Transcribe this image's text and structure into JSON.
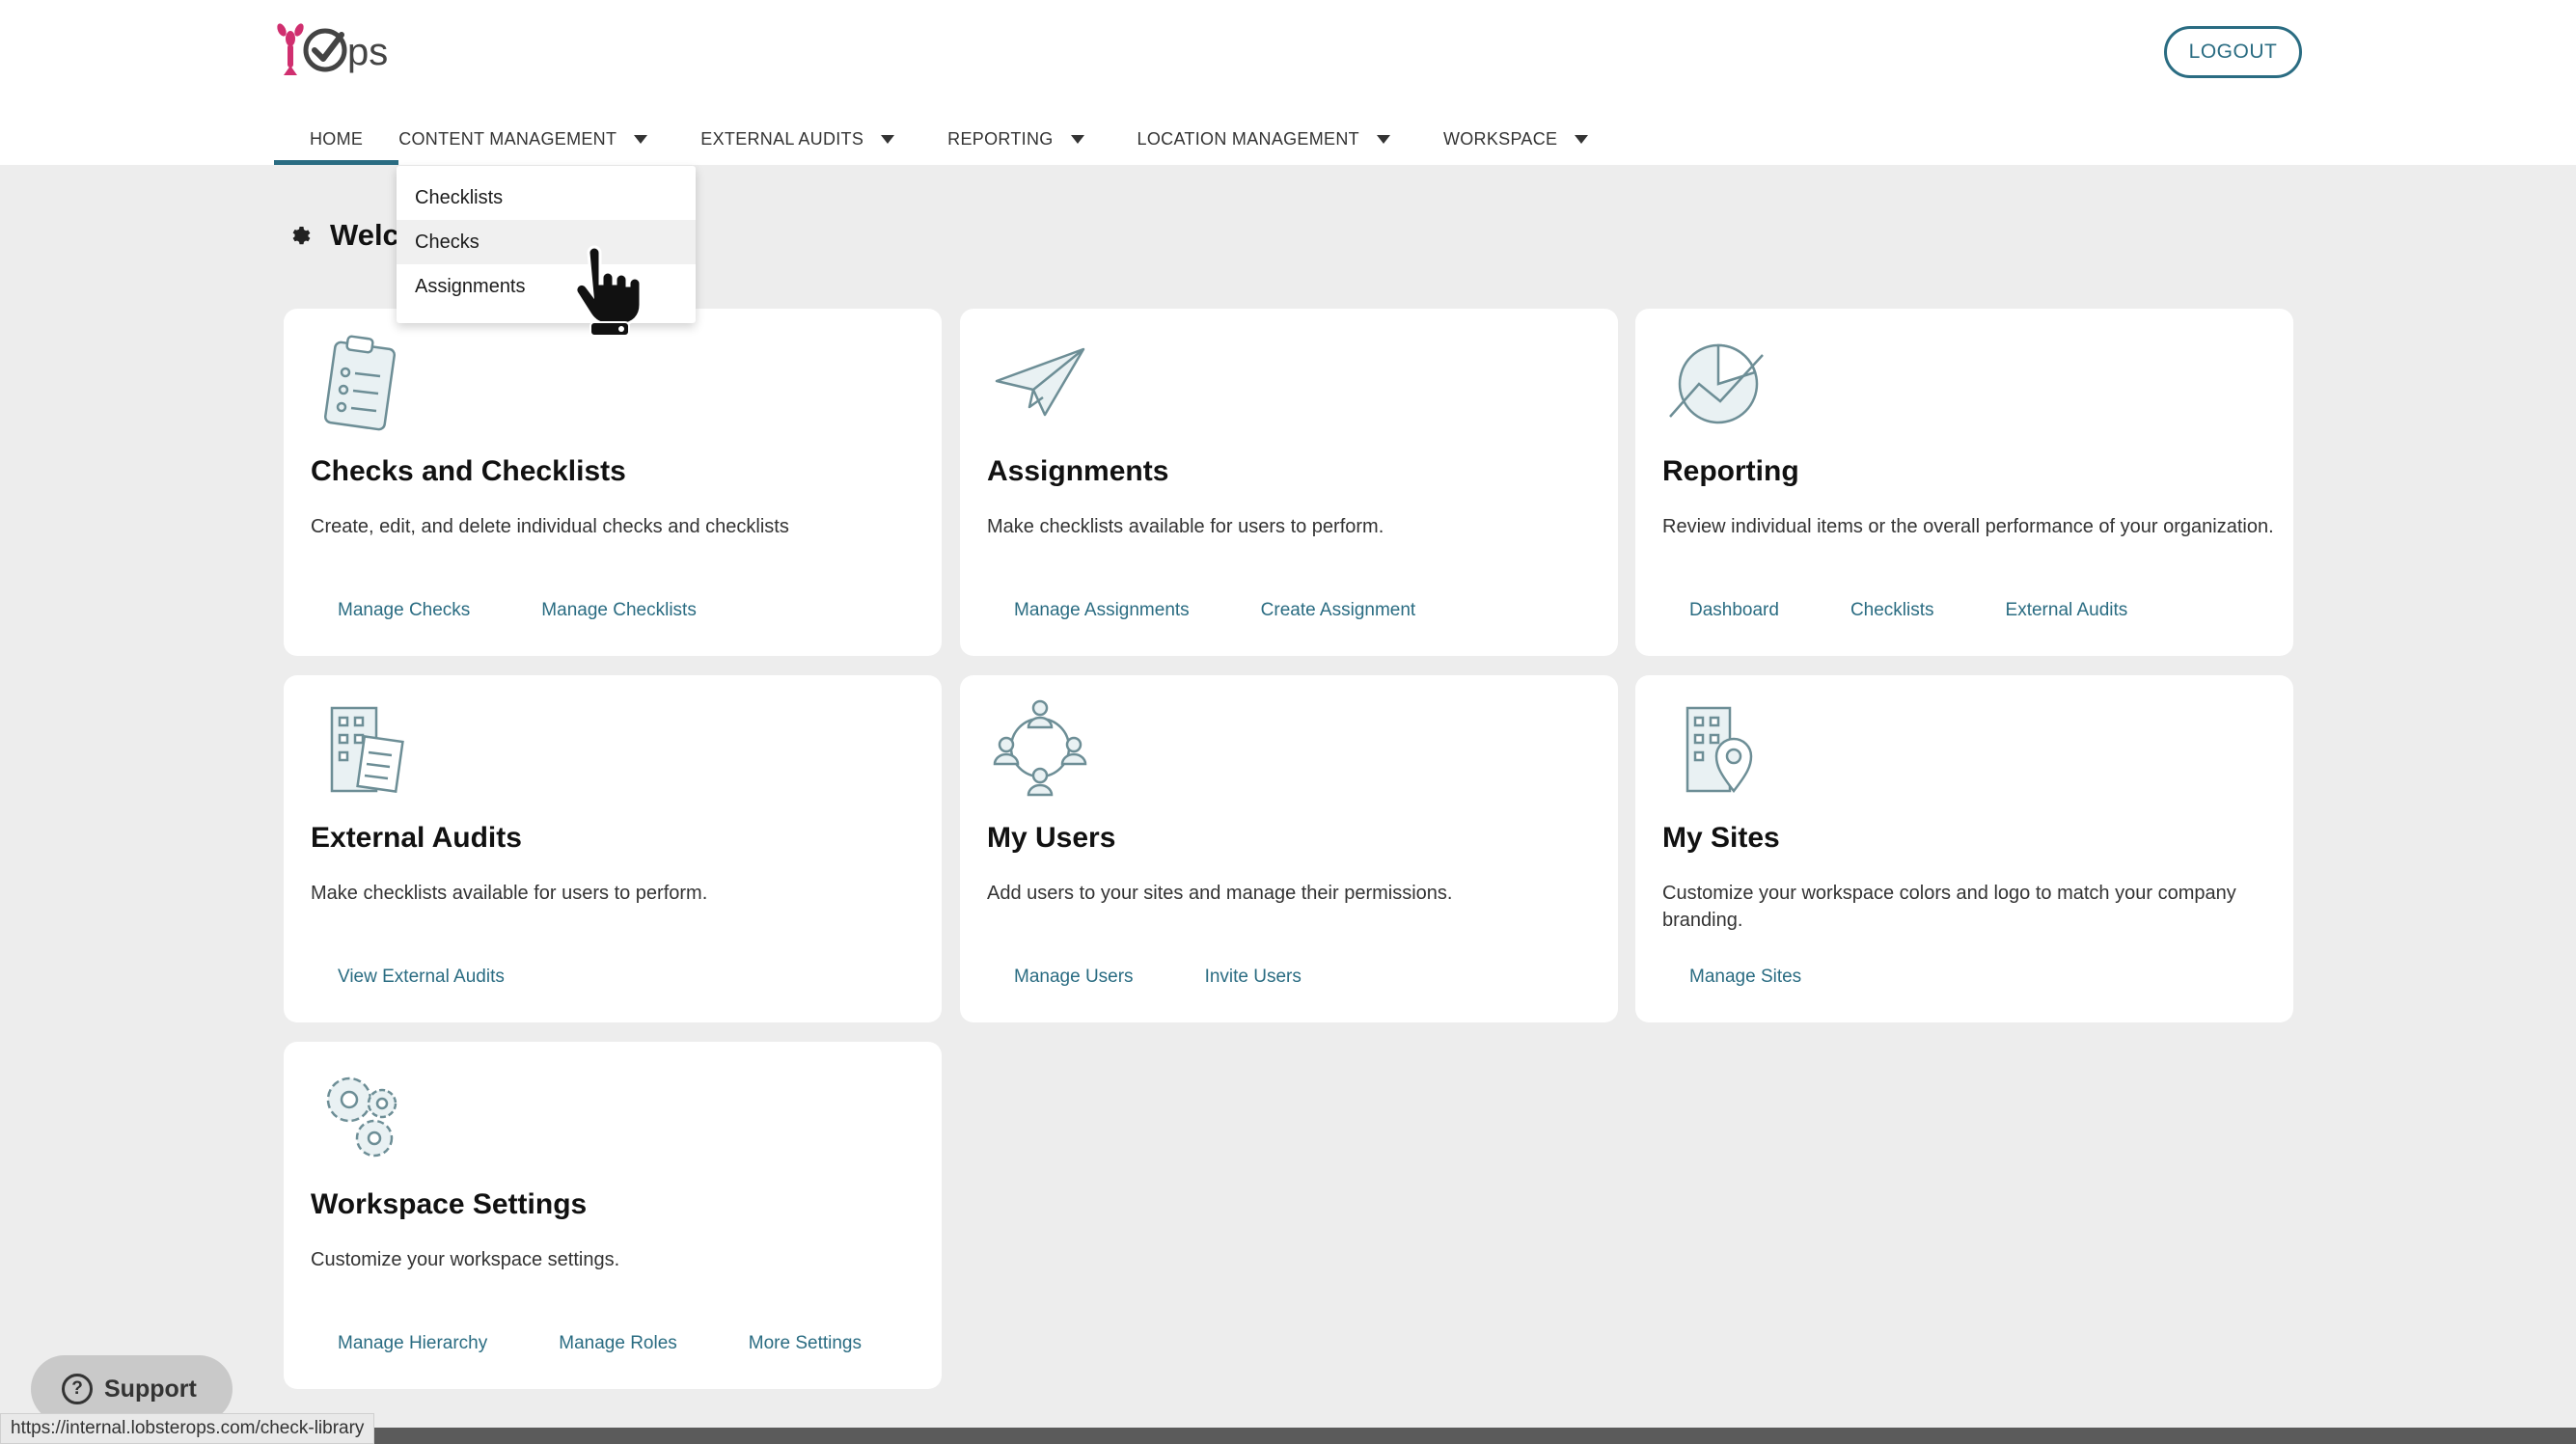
{
  "header": {
    "logo_text": "Ops",
    "logout_label": "LOGOUT"
  },
  "nav": {
    "items": [
      {
        "label": "HOME"
      },
      {
        "label": "CONTENT MANAGEMENT"
      },
      {
        "label": "EXTERNAL AUDITS"
      },
      {
        "label": "REPORTING"
      },
      {
        "label": "LOCATION MANAGEMENT"
      },
      {
        "label": "WORKSPACE"
      }
    ],
    "active": "HOME"
  },
  "dropdown": {
    "items": [
      {
        "label": "Checklists"
      },
      {
        "label": "Checks"
      },
      {
        "label": "Assignments"
      }
    ],
    "hovered": "Checks"
  },
  "welcome": {
    "title": "Welc"
  },
  "cards": [
    {
      "title": "Checks and Checklists",
      "desc": "Create, edit, and delete individual checks and checklists",
      "links": [
        "Manage Checks",
        "Manage Checklists"
      ],
      "icon": "clipboard-icon"
    },
    {
      "title": "Assignments",
      "desc": "Make checklists available for users to perform.",
      "links": [
        "Manage Assignments",
        "Create Assignment"
      ],
      "icon": "paper-plane-icon"
    },
    {
      "title": "Reporting",
      "desc": "Review individual items or the overall performance of your organization.",
      "links": [
        "Dashboard",
        "Checklists",
        "External Audits"
      ],
      "icon": "pie-chart-icon"
    },
    {
      "title": "External Audits",
      "desc": "Make checklists available for users to perform.",
      "links": [
        "View External Audits"
      ],
      "icon": "building-document-icon"
    },
    {
      "title": "My Users",
      "desc": "Add users to your sites and manage their permissions.",
      "links": [
        "Manage Users",
        "Invite Users"
      ],
      "icon": "users-network-icon"
    },
    {
      "title": "My Sites",
      "desc": "Customize your workspace colors and logo to match your company branding.",
      "links": [
        "Manage Sites"
      ],
      "icon": "building-pin-icon"
    },
    {
      "title": "Workspace Settings",
      "desc": "Customize your workspace settings.",
      "links": [
        "Manage Hierarchy",
        "Manage Roles",
        "More Settings"
      ],
      "icon": "gears-icon"
    }
  ],
  "support": {
    "label": "Support"
  },
  "status_url": "https://internal.lobsterops.com/check-library",
  "colors": {
    "accent": "#2a6c82",
    "logo_pink": "#d02f6f",
    "background": "#ededed"
  }
}
